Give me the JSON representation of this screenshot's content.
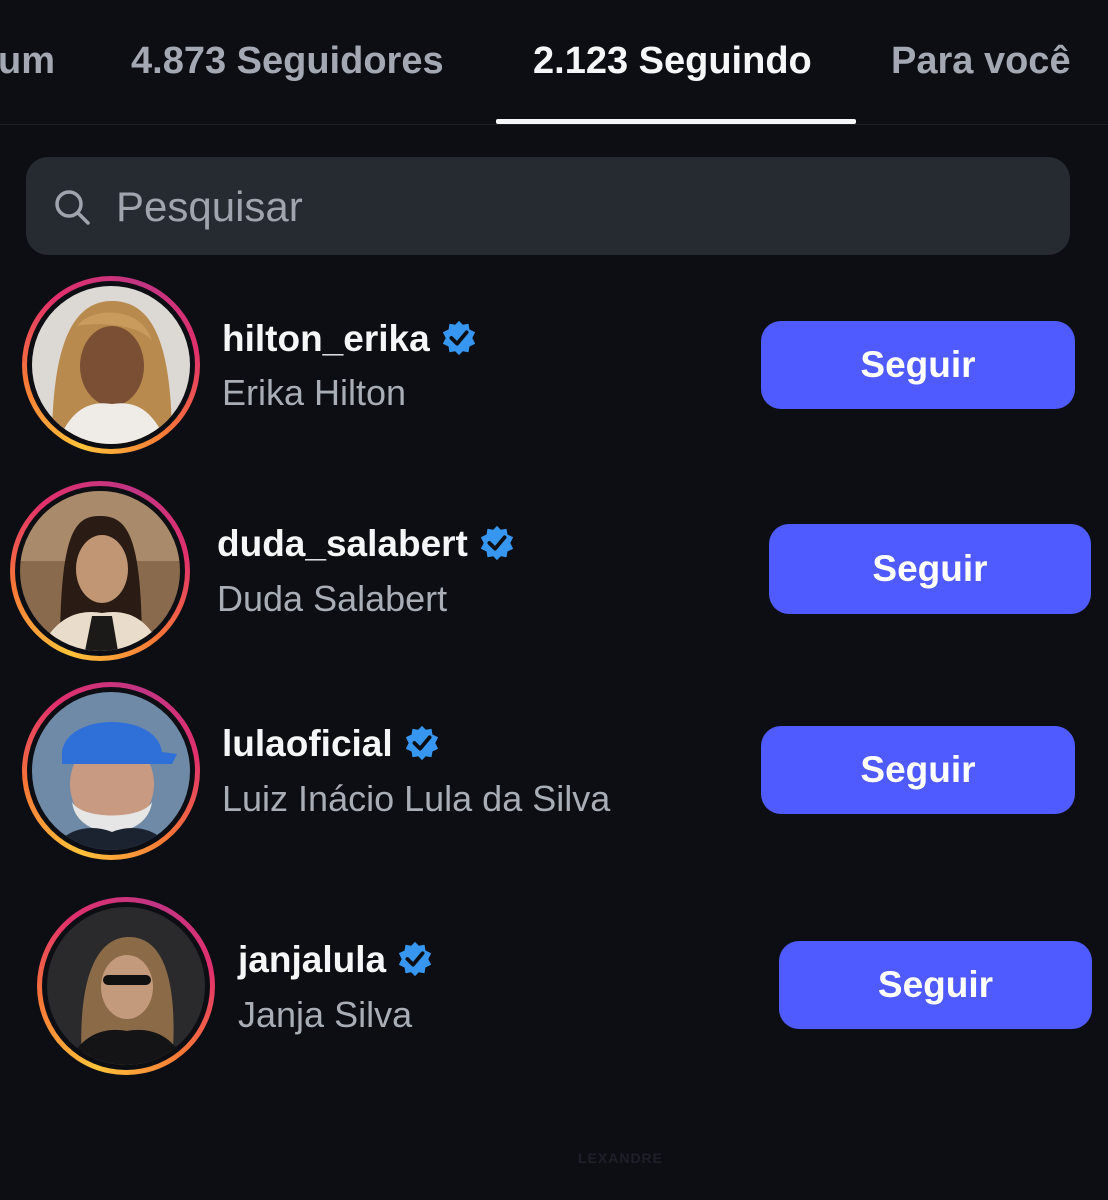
{
  "tabs": [
    {
      "label": "um"
    },
    {
      "label": "4.873 Seguidores"
    },
    {
      "label": "2.123 Seguindo",
      "active": true
    },
    {
      "label": "Para você"
    }
  ],
  "search": {
    "placeholder": "Pesquisar"
  },
  "accounts": [
    {
      "username": "hilton_erika",
      "name": "Erika Hilton",
      "verified": true,
      "button": "Seguir"
    },
    {
      "username": "duda_salabert",
      "name": "Duda Salabert",
      "verified": true,
      "button": "Seguir"
    },
    {
      "username": "lulaoficial",
      "name": "Luiz Inácio Lula da Silva",
      "verified": true,
      "button": "Seguir"
    },
    {
      "username": "janjalula",
      "name": "Janja Silva",
      "verified": true,
      "button": "Seguir"
    }
  ],
  "watermark": "LEXANDRE",
  "colors": {
    "background": "#0c0e14",
    "button": "#4f5bff",
    "verified": "#3797f0",
    "search_bg": "#262a31"
  }
}
